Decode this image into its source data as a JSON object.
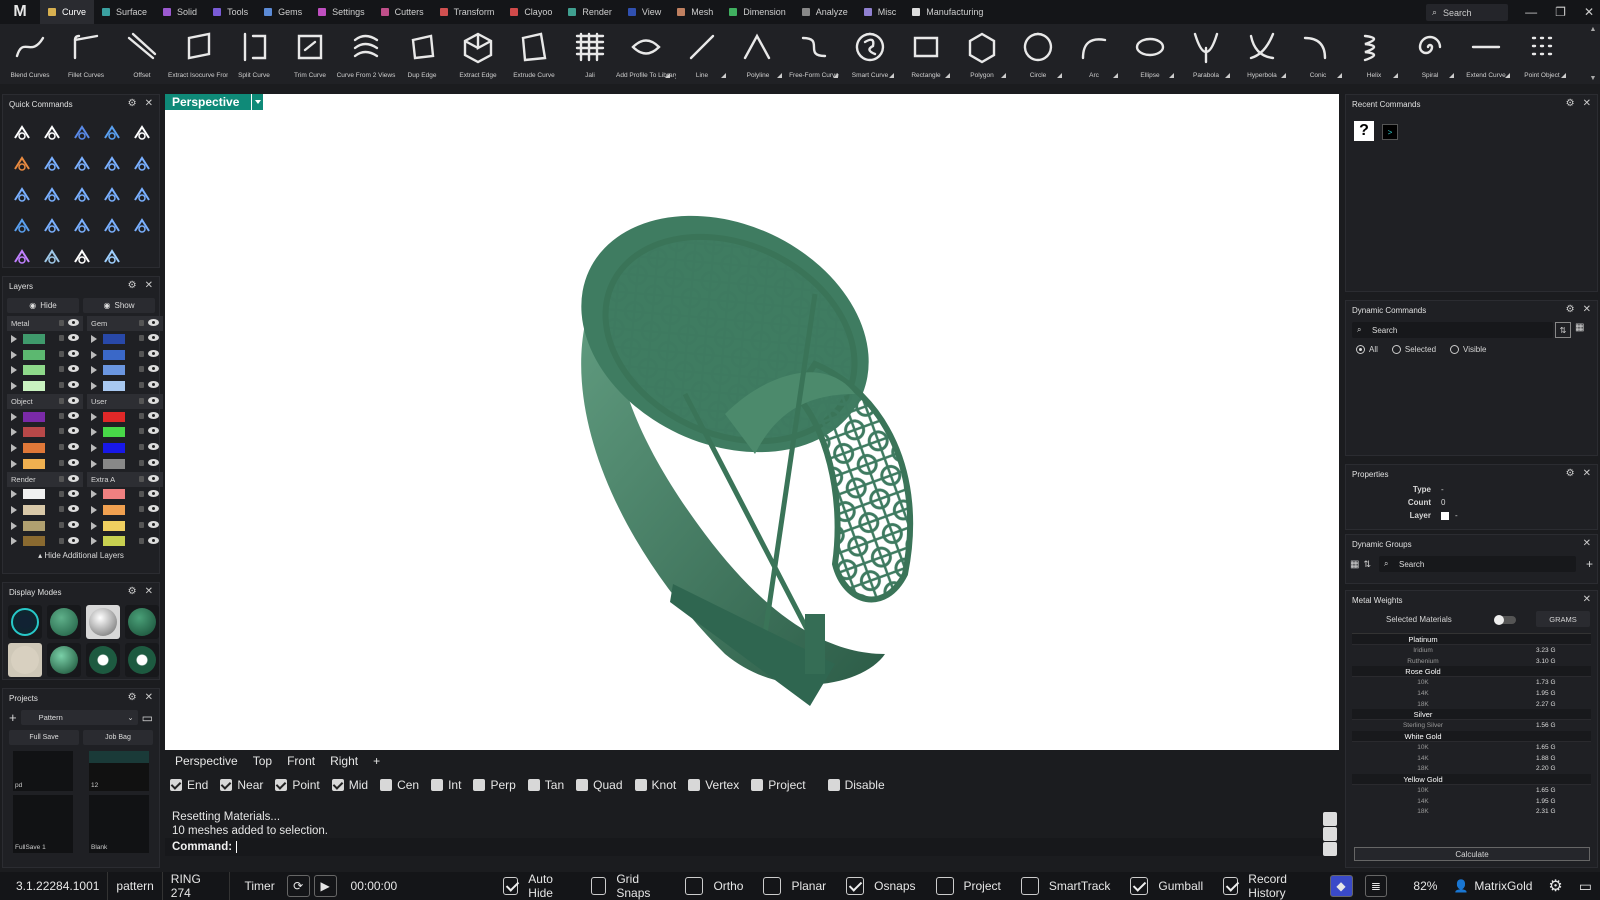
{
  "app": {
    "logo": "M"
  },
  "menu_tabs": [
    {
      "label": "Curve",
      "color": "#d8b050",
      "active": true
    },
    {
      "label": "Surface",
      "color": "#3aa0a0"
    },
    {
      "label": "Solid",
      "color": "#9b59d0"
    },
    {
      "label": "Tools",
      "color": "#7a5bd6"
    },
    {
      "label": "Gems",
      "color": "#5b8ad6"
    },
    {
      "label": "Settings",
      "color": "#c04fc0"
    },
    {
      "label": "Cutters",
      "color": "#c04f8a"
    },
    {
      "label": "Transform",
      "color": "#d05050"
    },
    {
      "label": "Clayoo",
      "color": "#d04a4a"
    },
    {
      "label": "Render",
      "color": "#40a090"
    },
    {
      "label": "View",
      "color": "#3050b0"
    },
    {
      "label": "Mesh",
      "color": "#c08060"
    },
    {
      "label": "Dimension",
      "color": "#40b060"
    },
    {
      "label": "Analyze",
      "color": "#888888"
    },
    {
      "label": "Misc",
      "color": "#9080d0"
    },
    {
      "label": "Manufacturing",
      "color": "#dddddd"
    }
  ],
  "top_search": {
    "placeholder": "Search"
  },
  "toolbar": [
    {
      "label": "Blend Curves",
      "icon": "blend-curves"
    },
    {
      "label": "Fillet Curves",
      "icon": "fillet-curves"
    },
    {
      "label": "Offset",
      "icon": "offset"
    },
    {
      "label": "Extract Isocurve From...",
      "icon": "extract-isocurve"
    },
    {
      "label": "Split Curve",
      "icon": "split-curve"
    },
    {
      "label": "Trim Curve",
      "icon": "trim-curve"
    },
    {
      "label": "Curve From 2 Views",
      "icon": "curve-2-views"
    },
    {
      "label": "Dup Edge",
      "icon": "dup-edge"
    },
    {
      "label": "Extract Edge",
      "icon": "extract-edge"
    },
    {
      "label": "Extrude Curve",
      "icon": "extrude-curve"
    },
    {
      "label": "Jali",
      "icon": "jali"
    },
    {
      "label": "Add Profile To Library",
      "icon": "add-profile"
    },
    {
      "label": "Line",
      "icon": "line"
    },
    {
      "label": "Polyline",
      "icon": "polyline"
    },
    {
      "label": "Free-Form Curve",
      "icon": "free-form-curve"
    },
    {
      "label": "Smart Curve",
      "icon": "smart-curve"
    },
    {
      "label": "Rectangle",
      "icon": "rectangle"
    },
    {
      "label": "Polygon",
      "icon": "polygon"
    },
    {
      "label": "Circle",
      "icon": "circle"
    },
    {
      "label": "Arc",
      "icon": "arc"
    },
    {
      "label": "Ellipse",
      "icon": "ellipse"
    },
    {
      "label": "Parabola",
      "icon": "parabola"
    },
    {
      "label": "Hyperbola",
      "icon": "hyperbola"
    },
    {
      "label": "Conic",
      "icon": "conic"
    },
    {
      "label": "Helix",
      "icon": "helix"
    },
    {
      "label": "Spiral",
      "icon": "spiral"
    },
    {
      "label": "Extend Curve",
      "icon": "extend-curve"
    },
    {
      "label": "Point Object",
      "icon": "point-object"
    }
  ],
  "quick_commands": {
    "title": "Quick Commands"
  },
  "layers": {
    "title": "Layers",
    "hide_label": "Hide",
    "show_label": "Show",
    "groups": [
      {
        "name": "Metal",
        "colors": [
          "#3f9a6c",
          "#5cb870",
          "#8ed98a",
          "#c9f2c0"
        ]
      },
      {
        "name": "Gem",
        "colors": [
          "#2848a8",
          "#3a68c8",
          "#6a96e0",
          "#a8c8f0"
        ]
      },
      {
        "name": "Object",
        "colors": [
          "#7a2aa8",
          "#b84848",
          "#e07838",
          "#f0b050"
        ]
      },
      {
        "name": "User",
        "colors": [
          "#e02828",
          "#48d848",
          "#1818e8",
          "#888888"
        ]
      },
      {
        "name": "Render",
        "colors": [
          "#f0f0f0",
          "#d8c8a8",
          "#b0a070",
          "#8a6a30"
        ]
      },
      {
        "name": "Extra A",
        "colors": [
          "#f08080",
          "#f0a050",
          "#f0d060",
          "#c8d050"
        ]
      }
    ],
    "hide_additional": "Hide Additional Layers"
  },
  "display_modes": {
    "title": "Display Modes"
  },
  "projects": {
    "title": "Projects",
    "selected": "Pattern",
    "full_save": "Full Save",
    "job_bag": "Job Bag",
    "thumbs": [
      "pd",
      "12",
      "FullSave 1",
      "Blank"
    ]
  },
  "viewport": {
    "tab": "Perspective"
  },
  "view_tabs": [
    "Perspective",
    "Top",
    "Front",
    "Right",
    "+"
  ],
  "osnaps": [
    {
      "label": "End",
      "on": true
    },
    {
      "label": "Near",
      "on": true
    },
    {
      "label": "Point",
      "on": true
    },
    {
      "label": "Mid",
      "on": true
    },
    {
      "label": "Cen",
      "on": false
    },
    {
      "label": "Int",
      "on": false
    },
    {
      "label": "Perp",
      "on": false
    },
    {
      "label": "Tan",
      "on": false
    },
    {
      "label": "Quad",
      "on": false
    },
    {
      "label": "Knot",
      "on": false
    },
    {
      "label": "Vertex",
      "on": false
    },
    {
      "label": "Project",
      "on": false
    },
    {
      "label": "Disable",
      "on": false
    }
  ],
  "command": {
    "log": [
      "Resetting Materials...",
      "10 meshes added to selection."
    ],
    "prompt": "Command:"
  },
  "recent_commands": {
    "title": "Recent Commands"
  },
  "dynamic_commands": {
    "title": "Dynamic Commands",
    "search": "Search",
    "filters": [
      {
        "label": "All",
        "on": true
      },
      {
        "label": "Selected",
        "on": false
      },
      {
        "label": "Visible",
        "on": false
      }
    ]
  },
  "properties": {
    "title": "Properties",
    "rows": [
      {
        "key": "Type",
        "value": "-"
      },
      {
        "key": "Count",
        "value": "0"
      },
      {
        "key": "Layer",
        "value": "-"
      }
    ]
  },
  "dynamic_groups": {
    "title": "Dynamic Groups",
    "search": "Search"
  },
  "metal_weights": {
    "title": "Metal Weights",
    "selected_materials": "Selected Materials",
    "unit": "GRAMS",
    "groups": [
      {
        "name": "Platinum",
        "rows": [
          {
            "name": "Iridium",
            "value": "3.23 G"
          },
          {
            "name": "Ruthenium",
            "value": "3.10 G"
          }
        ]
      },
      {
        "name": "Rose Gold",
        "rows": [
          {
            "name": "10K",
            "value": "1.73 G"
          },
          {
            "name": "14K",
            "value": "1.95 G"
          },
          {
            "name": "18K",
            "value": "2.27 G"
          }
        ]
      },
      {
        "name": "Silver",
        "rows": [
          {
            "name": "Sterling Silver",
            "value": "1.56 G"
          }
        ]
      },
      {
        "name": "White Gold",
        "rows": [
          {
            "name": "10K",
            "value": "1.65 G"
          },
          {
            "name": "14K",
            "value": "1.88 G"
          },
          {
            "name": "18K",
            "value": "2.20 G"
          }
        ]
      },
      {
        "name": "Yellow Gold",
        "rows": [
          {
            "name": "10K",
            "value": "1.65 G"
          },
          {
            "name": "14K",
            "value": "1.95 G"
          },
          {
            "name": "18K",
            "value": "2.31 G"
          }
        ]
      }
    ],
    "calculate": "Calculate"
  },
  "status": {
    "version": "3.1.22284.1001",
    "project": "pattern",
    "item": "RING 274",
    "timer_label": "Timer",
    "timer_value": "00:00:00",
    "toggles": [
      {
        "label": "Auto Hide",
        "on": true
      },
      {
        "label": "Grid Snaps",
        "on": false
      },
      {
        "label": "Ortho",
        "on": false
      },
      {
        "label": "Planar",
        "on": false
      },
      {
        "label": "Osnaps",
        "on": true
      },
      {
        "label": "Project",
        "on": false
      },
      {
        "label": "SmartTrack",
        "on": false
      },
      {
        "label": "Gumball",
        "on": true
      },
      {
        "label": "Record History",
        "on": true
      }
    ],
    "zoom": "82%",
    "user": "MatrixGold"
  }
}
